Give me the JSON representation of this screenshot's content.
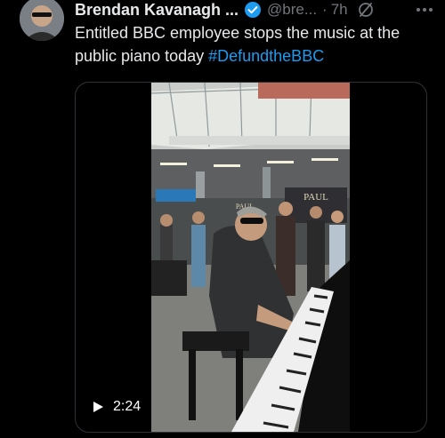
{
  "author": {
    "name": "Brendan Kavanagh ...",
    "handle": "@bre...",
    "separator": "·",
    "time": "7h"
  },
  "tweet": {
    "text": "Entitled BBC employee stops the music at the public piano today ",
    "hashtag": "#DefundtheBBC"
  },
  "media": {
    "duration": "2:24",
    "storefront_text": "PAUL"
  },
  "icons": {
    "verified": "verified-badge-icon",
    "grok": "grok-icon",
    "more": "more-icon",
    "play": "play-icon"
  },
  "colors": {
    "accent": "#1d9bf0",
    "muted": "#71767b",
    "text": "#e7e9ea",
    "background": "#000000"
  }
}
